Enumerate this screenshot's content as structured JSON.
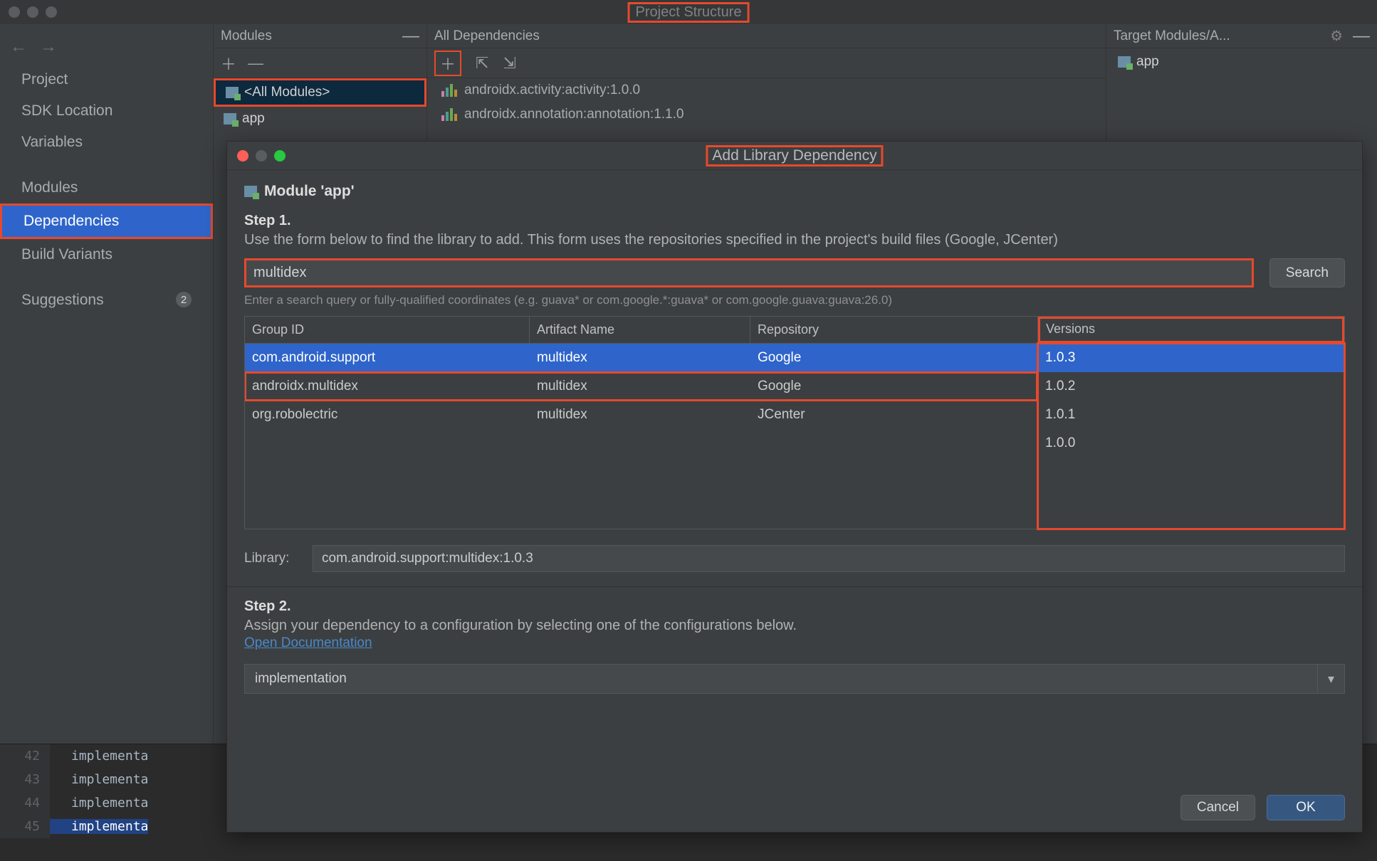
{
  "ps": {
    "title": "Project Structure",
    "nav": {
      "project": "Project",
      "sdk": "SDK Location",
      "variables": "Variables",
      "modules": "Modules",
      "dependencies": "Dependencies",
      "build_variants": "Build Variants",
      "suggestions": "Suggestions",
      "suggestions_badge": "2"
    },
    "modules_col": {
      "header": "Modules",
      "all": "<All Modules>",
      "app": "app"
    },
    "deps_col": {
      "header": "All Dependencies",
      "items": [
        "androidx.activity:activity:1.0.0",
        "androidx.annotation:annotation:1.1.0"
      ]
    },
    "target_col": {
      "header": "Target Modules/A...",
      "app": "app"
    }
  },
  "editor": {
    "lines": [
      {
        "num": "42",
        "text": "implementa"
      },
      {
        "num": "43",
        "text": "implementa"
      },
      {
        "num": "44",
        "text": "implementa"
      },
      {
        "num": "45",
        "text": "implementa"
      }
    ]
  },
  "dialog": {
    "title": "Add Library Dependency",
    "module": "Module 'app'",
    "step1": {
      "label": "Step 1.",
      "desc": "Use the form below to find the library to add. This form uses the repositories specified in the project's build files (Google, JCenter)",
      "search_value": "multidex",
      "search_button": "Search",
      "hint": "Enter a search query or fully-qualified coordinates (e.g. guava* or com.google.*:guava* or com.google.guava:guava:26.0)"
    },
    "table": {
      "headers": {
        "group": "Group ID",
        "artifact": "Artifact Name",
        "repo": "Repository",
        "ver": "Versions"
      },
      "rows": [
        {
          "group": "com.android.support",
          "artifact": "multidex",
          "repo": "Google",
          "selected": true,
          "hl": false
        },
        {
          "group": "androidx.multidex",
          "artifact": "multidex",
          "repo": "Google",
          "selected": false,
          "hl": true
        },
        {
          "group": "org.robolectric",
          "artifact": "multidex",
          "repo": "JCenter",
          "selected": false,
          "hl": false
        }
      ],
      "versions": [
        "1.0.3",
        "1.0.2",
        "1.0.1",
        "1.0.0"
      ],
      "selected_version": "1.0.3"
    },
    "library": {
      "label": "Library:",
      "value": "com.android.support:multidex:1.0.3"
    },
    "step2": {
      "label": "Step 2.",
      "desc": "Assign your dependency to a configuration by selecting one of the configurations below.",
      "doc_link": "Open Documentation",
      "config": "implementation"
    },
    "footer": {
      "cancel": "Cancel",
      "ok": "OK"
    }
  }
}
